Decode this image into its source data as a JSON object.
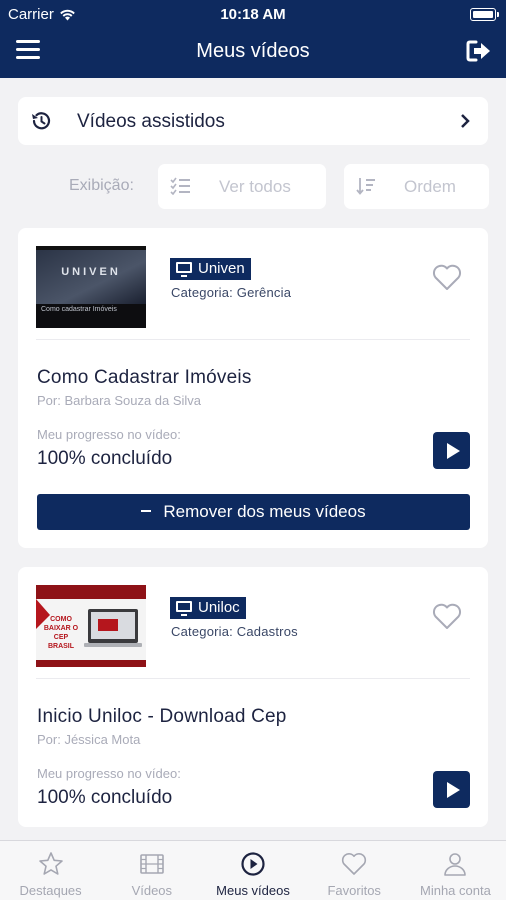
{
  "status_bar": {
    "carrier": "Carrier",
    "time": "10:18 AM"
  },
  "header": {
    "title": "Meus vídeos"
  },
  "watched": {
    "label": "Vídeos assistidos"
  },
  "filters": {
    "label": "Exibição:",
    "view_all": "Ver todos",
    "order": "Ordem"
  },
  "videos": [
    {
      "thumb_title": "UNIVEN",
      "thumb_caption": "Como cadastrar Imóveis",
      "badge": "Univen",
      "category": "Categoria: Gerência",
      "title": "Como Cadastrar Imóveis",
      "author": "Por: Barbara Souza da Silva",
      "progress_label": "Meu progresso no vídeo:",
      "progress_value": "100% concluído",
      "remove_label": "Remover dos meus vídeos"
    },
    {
      "thumb_title": "COMO BAIXAR O CEP BRASIL",
      "badge": "Uniloc",
      "category": "Categoria: Cadastros",
      "title": "Inicio Uniloc - Download Cep",
      "author": "Por: Jéssica Mota",
      "progress_label": "Meu progresso no vídeo:",
      "progress_value": "100% concluído"
    }
  ],
  "tabs": [
    {
      "label": "Destaques",
      "icon": "star-icon"
    },
    {
      "label": "Vídeos",
      "icon": "film-icon"
    },
    {
      "label": "Meus vídeos",
      "icon": "play-circle-icon",
      "active": true
    },
    {
      "label": "Favoritos",
      "icon": "heart-icon"
    },
    {
      "label": "Minha conta",
      "icon": "user-icon"
    }
  ],
  "colors": {
    "primary": "#0e2a5f",
    "background": "#f2f2f4",
    "muted": "#a9abb8"
  }
}
